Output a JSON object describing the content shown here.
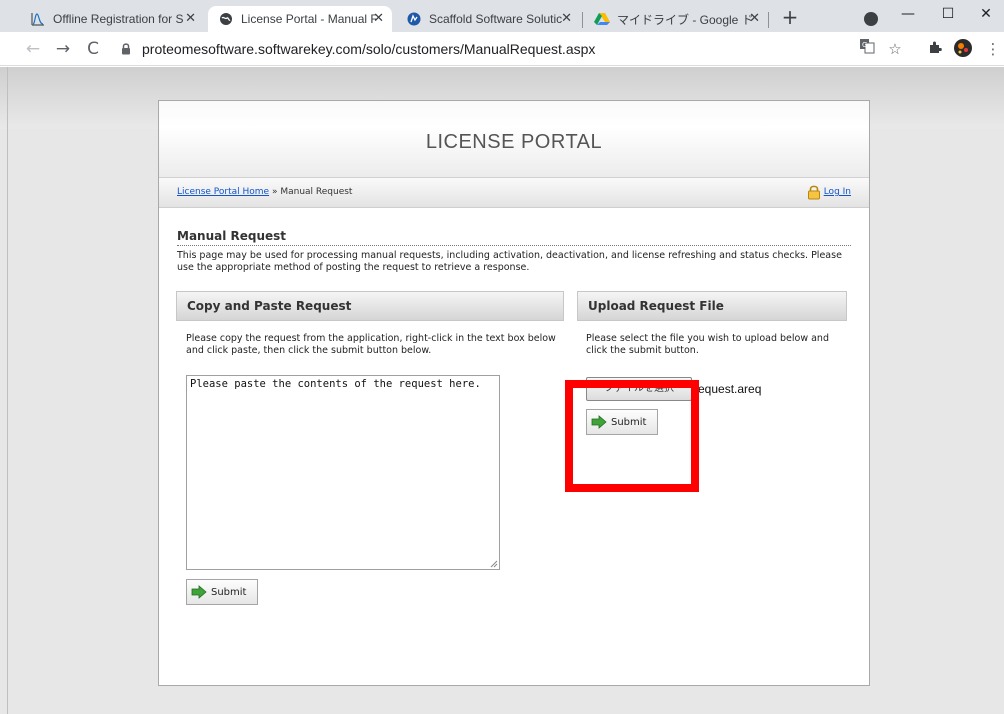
{
  "browser": {
    "tabs": [
      {
        "title": "Offline Registration for S",
        "icon": "chart-icon",
        "active": false
      },
      {
        "title": "License Portal - Manual R",
        "icon": "globe-icon",
        "active": true
      },
      {
        "title": "Scaffold Software Solutic",
        "icon": "scaffold-icon",
        "active": false
      },
      {
        "title": "マイドライブ - Google ドライ",
        "icon": "google-drive-icon",
        "active": false
      }
    ],
    "url": "proteomesoftware.softwarekey.com/solo/customers/ManualRequest.aspx",
    "window_controls": {
      "minimize": "—",
      "maximize": "☐",
      "close": "✕"
    }
  },
  "portal": {
    "title": "LICENSE PORTAL",
    "breadcrumb": {
      "home": "License Portal Home",
      "separator": " » ",
      "current": "Manual Request"
    },
    "login_label": "Log In"
  },
  "manual_request": {
    "heading": "Manual Request",
    "intro": "This page may be used for processing manual requests, including activation, deactivation, and license refreshing and status checks. Please use the appropriate method of posting the request to retrieve a response."
  },
  "copy_paste": {
    "heading": "Copy and Paste Request",
    "instructions": "Please copy the request from the application, right-click in the text box below and click paste, then click the submit button below.",
    "textarea_value": "Please paste the contents of the request here.",
    "submit_label": "Submit"
  },
  "upload": {
    "heading": "Upload Request File",
    "instructions": "Please select the file you wish to upload below and click the submit button.",
    "choose_file_label": "ファイルを選択",
    "file_name": "request.areq",
    "submit_label": "Submit"
  },
  "colors": {
    "highlight": "#ff0000",
    "link": "#1155cc",
    "submit_arrow": "#3fa33a"
  }
}
